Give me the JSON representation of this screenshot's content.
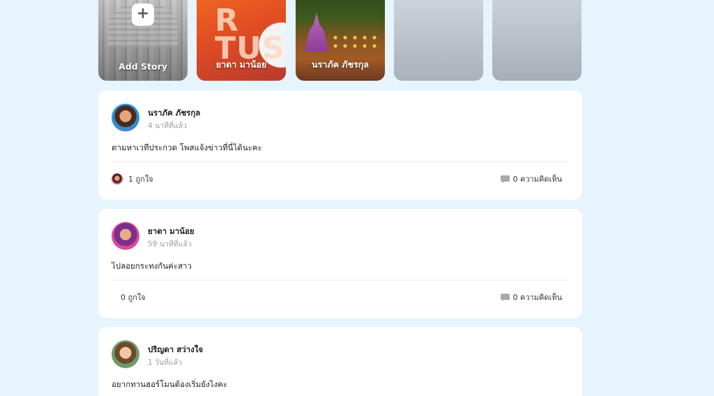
{
  "stories": [
    {
      "name": "Add Story",
      "add_icon": "+"
    },
    {
      "name": "ยาดา มาน้อย",
      "overlay_text": "R\nTUS"
    },
    {
      "name": "นราภัค ภัชรกุล"
    },
    {
      "name": ""
    },
    {
      "name": ""
    }
  ],
  "posts": [
    {
      "author": "นราภัค ภัชรกุล",
      "time": "4 นาทีที่แล้ว",
      "content": "ตามหาเวทีประกวด โพสแจ้งข่าวที่นี่ได้นะคะ",
      "likes": "1 ถูกใจ",
      "comments": "0 ความคิดเห็น"
    },
    {
      "author": "ยาดา มาน้อย",
      "time": "59 นาทีที่แล้ว",
      "content": "ไปลอยกระทงกันค่ะสาว",
      "likes": "0 ถูกใจ",
      "comments": "0 ความคิดเห็น"
    },
    {
      "author": "ปริญดา สว่างใจ",
      "time": "1 วันที่แล้ว",
      "content": "อยากทานฮอร์โมนต้องเริ่มยังไงคะ"
    }
  ]
}
